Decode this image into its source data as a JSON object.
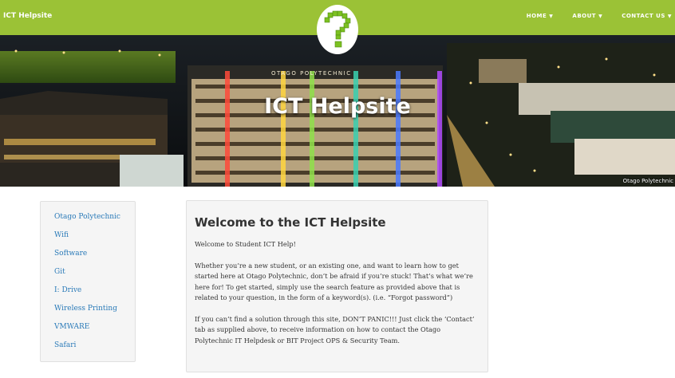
{
  "header": {
    "site_title": "ICT Helpsite",
    "nav": [
      {
        "label": "HOME",
        "caret": "▼"
      },
      {
        "label": "ABOUT",
        "caret": "▼"
      },
      {
        "label": "CONTACT US",
        "caret": "▼"
      }
    ],
    "logo_icon": "question-mark-icon"
  },
  "hero": {
    "title": "ICT Helpsite",
    "sign_text": "OTAGO POLYTECHNIC",
    "caption": "Otago Polytechnic"
  },
  "sidebar": {
    "items": [
      {
        "label": "Otago Polytechnic"
      },
      {
        "label": "Wifi"
      },
      {
        "label": "Software"
      },
      {
        "label": "Git"
      },
      {
        "label": "I: Drive"
      },
      {
        "label": "Wireless Printing"
      },
      {
        "label": "VMWARE"
      },
      {
        "label": "Safari"
      }
    ]
  },
  "main": {
    "heading": "Welcome to the ICT Helpsite",
    "paragraphs": [
      "Welcome to Student ICT Help!",
      "Whether you’re a new student, or an existing one, and want to learn how to get started here at Otago Polytechnic, don’t be afraid if you’re stuck! That’s what we’re here for! To get started, simply use the search feature as provided above that is related to your question, in the form of a keyword(s). (i.e. “Forgot password”)",
      "If you can’t find a solution through this site, DON’T PANIC!!! Just click the ‘Contact’ tab as supplied above, to receive information on how to contact the Otago Polytechnic IT Helpdesk or BIT Project OPS & Security Team."
    ]
  },
  "colors": {
    "header_green": "#9bc236",
    "link_blue": "#2a7ab8",
    "logo_green": "#7cc121"
  }
}
